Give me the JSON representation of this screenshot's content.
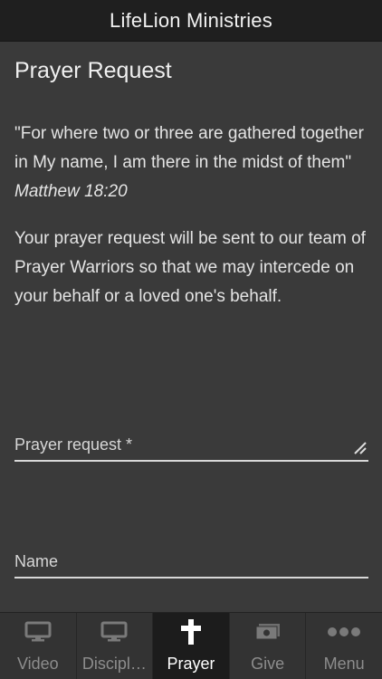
{
  "header": {
    "title": "LifeLion Ministries"
  },
  "page": {
    "title": "Prayer Request",
    "quote": "\"For where two or three are gathered together in My name, I am there in the midst of them\"",
    "quote_ref": "Matthew 18:20",
    "info": "Your prayer request will be sent to our team of Prayer Warriors so that we may intercede on your behalf or a loved one's behalf."
  },
  "form": {
    "prayer_placeholder": "Prayer request *",
    "name_placeholder": "Name"
  },
  "tabs": [
    {
      "label": "Video",
      "icon": "monitor-icon",
      "active": false
    },
    {
      "label": "Discipl…",
      "icon": "monitor-icon",
      "active": false
    },
    {
      "label": "Prayer",
      "icon": "cross-icon",
      "active": true
    },
    {
      "label": "Give",
      "icon": "money-icon",
      "active": false
    },
    {
      "label": "Menu",
      "icon": "more-dots-icon",
      "active": false
    }
  ]
}
